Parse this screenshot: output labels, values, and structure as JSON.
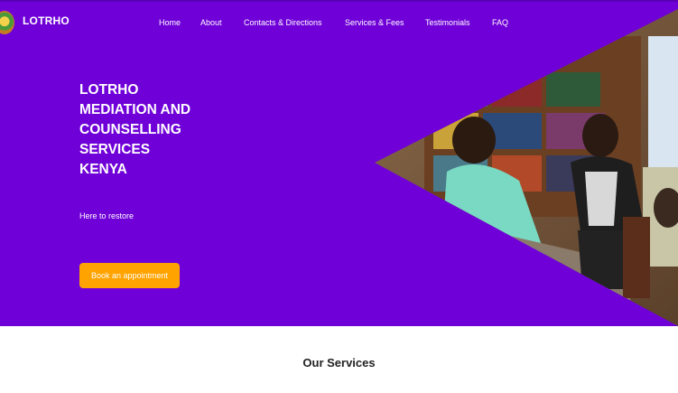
{
  "header": {
    "brand": "LOTRHO",
    "logo_icon": "lotrho-emblem-icon",
    "nav": [
      "Home",
      "About",
      "Contacts & Directions",
      "Services & Fees",
      "Testimonials",
      "FAQ"
    ]
  },
  "hero": {
    "title_lines": [
      "LOTRHO",
      "MEDIATION AND",
      "COUNSELLING",
      "SERVICES",
      "KENYA"
    ],
    "tagline": "Here to restore",
    "cta": "Book an appointment",
    "photo_icon": "counselling-session-photo"
  },
  "services": {
    "heading": "Our Services"
  },
  "colors": {
    "hero_bg": "#6f00d8",
    "cta_bg": "#ffa300",
    "text_light": "#ffffff"
  }
}
